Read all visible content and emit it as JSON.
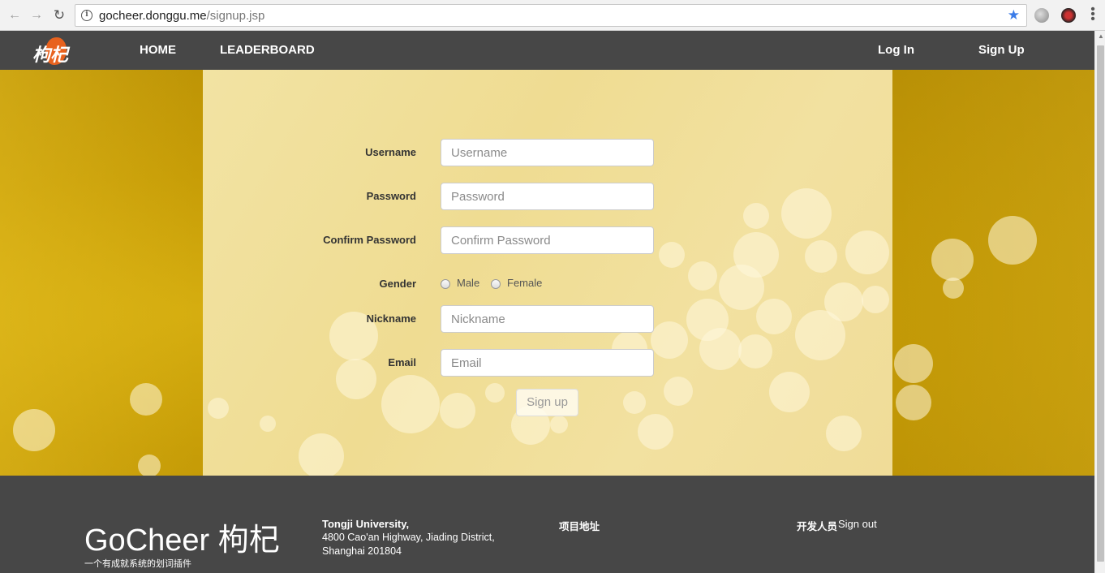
{
  "browser": {
    "url_host": "gocheer.donggu.me",
    "url_path": "/signup.jsp"
  },
  "nav": {
    "logo_text": "枸杞",
    "home": "HOME",
    "leaderboard": "LEADERBOARD",
    "login": "Log In",
    "signup": "Sign Up"
  },
  "form": {
    "username_label": "Username",
    "username_placeholder": "Username",
    "password_label": "Password",
    "password_placeholder": "Password",
    "confirm_label": "Confirm Password",
    "confirm_placeholder": "Confirm Password",
    "gender_label": "Gender",
    "gender_options": [
      "Male",
      "Female"
    ],
    "nickname_label": "Nickname",
    "nickname_placeholder": "Nickname",
    "email_label": "Email",
    "email_placeholder": "Email",
    "submit_label": "Sign up"
  },
  "footer": {
    "brand": "GoCheer 枸杞",
    "tagline": "一个有成就系统的划词插件",
    "address_title": "Tongji University,",
    "address_line1": "4800 Cao'an Highway, Jiading District,",
    "address_line2": "Shanghai 201804",
    "project_heading": "项目地址",
    "developers_heading": "开发人员",
    "signout_link": "Sign out"
  },
  "colors": {
    "nav_bg": "#474747",
    "hero_gold": "#c79d07",
    "panel_cream": "#f0dc98",
    "logo_accent": "#e8621e",
    "bookmark_star": "#3b7ce8"
  }
}
